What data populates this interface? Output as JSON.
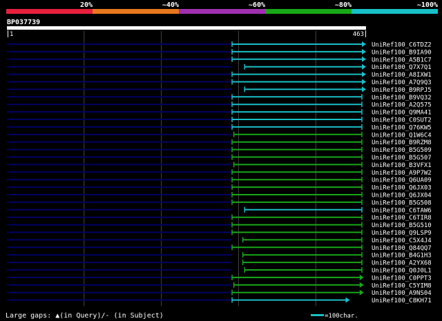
{
  "legend": {
    "labels": [
      "20%",
      "~40%",
      "~60%",
      "~80%",
      "~100%"
    ],
    "colors": [
      "#e8203c",
      "#e8781e",
      "#a030b0",
      "#18a818",
      "#18c0c8"
    ]
  },
  "query": {
    "name": "BP037739",
    "start": "1",
    "end": "463",
    "length": 463
  },
  "hits": [
    {
      "id": "UniRef100_C6TDZ2",
      "qstart": 1,
      "qend": 463,
      "color": "cyan",
      "arrow": true
    },
    {
      "id": "UniRef100_B9IA90",
      "qstart": 1,
      "qend": 463,
      "color": "cyan",
      "arrow": true
    },
    {
      "id": "UniRef100_A5B1C7",
      "qstart": 1,
      "qend": 463,
      "color": "cyan",
      "arrow": true
    },
    {
      "id": "UniRef100_Q7X7Q1",
      "qstart": 8,
      "qend": 463,
      "color": "cyan",
      "arrow": true
    },
    {
      "id": "UniRef100_A8IXW1",
      "qstart": 1,
      "qend": 463,
      "color": "cyan",
      "arrow": true
    },
    {
      "id": "UniRef100_A7Q9Q3",
      "qstart": 1,
      "qend": 463,
      "color": "cyan",
      "arrow": true
    },
    {
      "id": "UniRef100_B9RPJ5",
      "qstart": 8,
      "qend": 463,
      "color": "cyan",
      "arrow": true
    },
    {
      "id": "UniRef100_B9VQ32",
      "qstart": 1,
      "qend": 463,
      "color": "cyan",
      "arrow": false
    },
    {
      "id": "UniRef100_A2Q575",
      "qstart": 1,
      "qend": 463,
      "color": "cyan",
      "arrow": false
    },
    {
      "id": "UniRef100_Q9MA41",
      "qstart": 1,
      "qend": 463,
      "color": "cyan",
      "arrow": false
    },
    {
      "id": "UniRef100_C0SUT2",
      "qstart": 1,
      "qend": 463,
      "color": "cyan",
      "arrow": false
    },
    {
      "id": "UniRef100_Q76KW5",
      "qstart": 1,
      "qend": 463,
      "color": "cyan",
      "arrow": false
    },
    {
      "id": "UniRef100_Q1W6C4",
      "qstart": 2,
      "qend": 463,
      "color": "green",
      "arrow": false
    },
    {
      "id": "UniRef100_B9RZM8",
      "qstart": 1,
      "qend": 463,
      "color": "green",
      "arrow": false
    },
    {
      "id": "UniRef100_B5G509",
      "qstart": 1,
      "qend": 463,
      "color": "green",
      "arrow": false
    },
    {
      "id": "UniRef100_B5G507",
      "qstart": 1,
      "qend": 463,
      "color": "green",
      "arrow": false
    },
    {
      "id": "UniRef100_B3VFX1",
      "qstart": 2,
      "qend": 463,
      "color": "green",
      "arrow": false
    },
    {
      "id": "UniRef100_A9P7W2",
      "qstart": 1,
      "qend": 463,
      "color": "green",
      "arrow": false
    },
    {
      "id": "UniRef100_Q6UA09",
      "qstart": 1,
      "qend": 463,
      "color": "green",
      "arrow": false
    },
    {
      "id": "UniRef100_Q6JX03",
      "qstart": 1,
      "qend": 463,
      "color": "green",
      "arrow": false
    },
    {
      "id": "UniRef100_Q6JX04",
      "qstart": 1,
      "qend": 463,
      "color": "green",
      "arrow": false
    },
    {
      "id": "UniRef100_B5G508",
      "qstart": 1,
      "qend": 463,
      "color": "green",
      "arrow": false
    },
    {
      "id": "UniRef100_C6TAW6",
      "qstart": 8,
      "qend": 463,
      "color": "cyan",
      "arrow": false
    },
    {
      "id": "UniRef100_C6TIR8",
      "qstart": 1,
      "qend": 463,
      "color": "green",
      "arrow": false
    },
    {
      "id": "UniRef100_B5G510",
      "qstart": 1,
      "qend": 463,
      "color": "green",
      "arrow": false
    },
    {
      "id": "UniRef100_Q9LSP9",
      "qstart": 1,
      "qend": 463,
      "color": "green",
      "arrow": false
    },
    {
      "id": "UniRef100_C5X4J4",
      "qstart": 7,
      "qend": 463,
      "color": "green",
      "arrow": false
    },
    {
      "id": "UniRef100_Q84QQ7",
      "qstart": 1,
      "qend": 463,
      "color": "green",
      "arrow": false
    },
    {
      "id": "UniRef100_B4G1H3",
      "qstart": 7,
      "qend": 463,
      "color": "green",
      "arrow": false
    },
    {
      "id": "UniRef100_A2YX68",
      "qstart": 7,
      "qend": 463,
      "color": "green",
      "arrow": false
    },
    {
      "id": "UniRef100_Q0J0L1",
      "qstart": 8,
      "qend": 463,
      "color": "green",
      "arrow": false
    },
    {
      "id": "UniRef100_C0PPT3",
      "qstart": 1,
      "qend": 455,
      "color": "green",
      "arrow": true
    },
    {
      "id": "UniRef100_C5YIM8",
      "qstart": 2,
      "qend": 455,
      "color": "green",
      "arrow": true
    },
    {
      "id": "UniRef100_A9NS04",
      "qstart": 1,
      "qend": 455,
      "color": "green",
      "arrow": true
    },
    {
      "id": "UniRef100_C8KH71",
      "qstart": 1,
      "qend": 405,
      "color": "cyan",
      "arrow": true
    }
  ],
  "footer": {
    "gaps_label": "Large gaps: ▲(in Query)/- (in Subject)",
    "scale_label": "=100char."
  },
  "colors": {
    "cyan": "#18c0c8",
    "green": "#18a818",
    "track": "#000066",
    "grid": "#444444"
  }
}
